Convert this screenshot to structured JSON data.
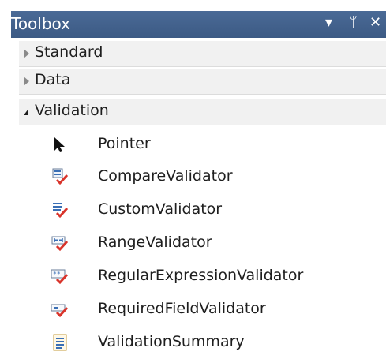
{
  "toolbox": {
    "title": "Toolbox",
    "controls": {
      "dropdown": "▾",
      "pin": "ᛘ",
      "close": "✕"
    }
  },
  "groups": [
    {
      "label": "Standard",
      "expanded": false
    },
    {
      "label": "Data",
      "expanded": false
    },
    {
      "label": "Validation",
      "expanded": true
    }
  ],
  "validation_items": [
    {
      "label": "Pointer",
      "icon": "pointer-icon"
    },
    {
      "label": "CompareValidator",
      "icon": "compare-validator-icon"
    },
    {
      "label": "CustomValidator",
      "icon": "custom-validator-icon"
    },
    {
      "label": "RangeValidator",
      "icon": "range-validator-icon"
    },
    {
      "label": "RegularExpressionValidator",
      "icon": "regex-validator-icon"
    },
    {
      "label": "RequiredFieldValidator",
      "icon": "required-field-validator-icon"
    },
    {
      "label": "ValidationSummary",
      "icon": "validation-summary-icon"
    }
  ],
  "colors": {
    "titlebar": "#3c5a84",
    "group_bg": "#f1f1f1",
    "check_red": "#d9342b",
    "icon_blue": "#3a6fb5"
  }
}
